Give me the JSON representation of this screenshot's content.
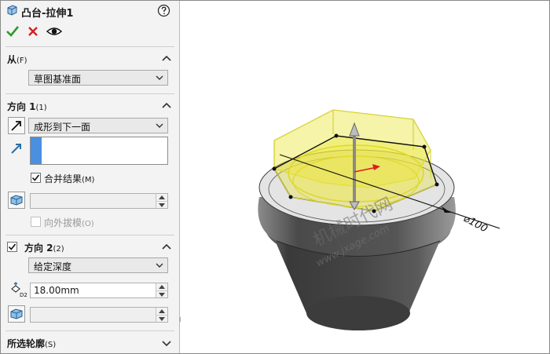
{
  "header": {
    "title": "凸台-拉伸1",
    "help_icon": "question-circle-icon",
    "feature_icon": "extrude-boss-icon",
    "ok_icon": "checkmark-icon",
    "cancel_icon": "close-icon",
    "preview_icon": "eye-icon"
  },
  "from": {
    "title": "从",
    "hotkey": "(F)",
    "selected": "草图基准面"
  },
  "direction1": {
    "title": "方向 1",
    "hotkey": "(1)",
    "end_condition": "成形到下一面",
    "merge_label": "合并结果",
    "merge_hotkey": "(M)",
    "merge_checked": true,
    "draft_label": "向外拔模",
    "draft_hotkey": "(O)",
    "draft_checked": false
  },
  "direction2": {
    "title": "方向 2",
    "hotkey": "(2)",
    "checked": true,
    "end_condition": "给定深度",
    "depth_value": "18.00mm"
  },
  "selected_contours": {
    "title": "所选轮廓",
    "hotkey": "(S)"
  },
  "viewport": {
    "dimension_label": "⌀100",
    "watermark_cn": "机械时代网",
    "watermark_url": "www.jxage.com"
  },
  "colors": {
    "ok_green": "#2e9a2e",
    "cancel_red": "#d42020",
    "preview_yellow": "#e8e430",
    "selection_blue": "#4a8fe0"
  }
}
